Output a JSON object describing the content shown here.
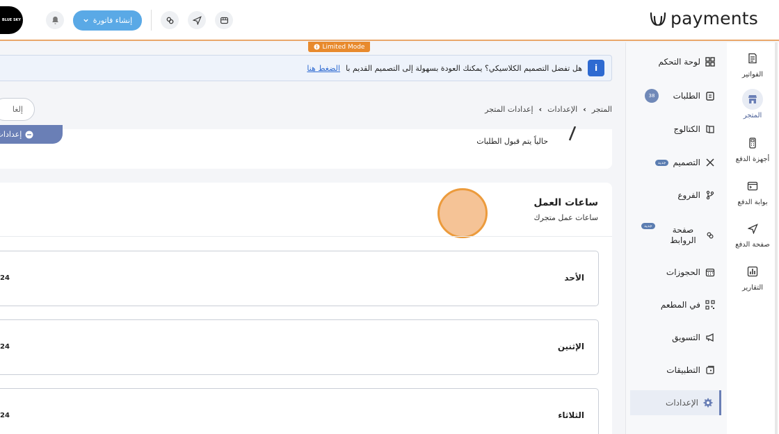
{
  "brand": {
    "name": "payments"
  },
  "header": {
    "avatar_text": "BLUE SKY",
    "create_invoice_label": "إنشاء فاتورة"
  },
  "limited_mode": "Limited Mode",
  "notice": {
    "text": "هل تفضل التصميم الكلاسيكي؟ يمكنك العودة بسهولة إلى التصميم القديم با",
    "link": "الضغط هنا"
  },
  "rail": [
    {
      "label": "الفواتير",
      "icon": "invoice-icon"
    },
    {
      "label": "المتجر",
      "icon": "store-icon"
    },
    {
      "label": "أجهزة الدفع",
      "icon": "pos-device-icon"
    },
    {
      "label": "بوابة الدفع",
      "icon": "gateway-icon"
    },
    {
      "label": "صفحة الدفع",
      "icon": "send-icon"
    },
    {
      "label": "التقارير",
      "icon": "reports-icon"
    }
  ],
  "menu": [
    {
      "label": "لوحة التحكم",
      "icon": "grid-icon"
    },
    {
      "label": "الطلبات",
      "icon": "orders-icon",
      "count": "38"
    },
    {
      "label": "الكتالوج",
      "icon": "catalog-icon"
    },
    {
      "label": "التصميم",
      "icon": "design-icon",
      "badge": "جديد"
    },
    {
      "label": "الفروع",
      "icon": "branch-icon"
    },
    {
      "label": "صفحة الروابط",
      "icon": "link-icon",
      "badge": "جديد"
    },
    {
      "label": "الحجوزات",
      "icon": "calendar-icon"
    },
    {
      "label": "في المطعم",
      "icon": "qr-icon"
    },
    {
      "label": "التسويق",
      "icon": "megaphone-icon"
    },
    {
      "label": "التطبيقات",
      "icon": "apps-icon"
    },
    {
      "label": "الإعدادات",
      "icon": "gear-icon"
    }
  ],
  "breadcrumb": [
    "المتجر",
    "الإعدادات",
    "إعدادات المتجر"
  ],
  "cancel_label": "إلغا",
  "store_status": {
    "accept_text": "حالياً يتم قبول الطلبات",
    "pill_label": "إعدادات ال"
  },
  "working_hours": {
    "title": "ساعات العمل",
    "subtitle": "ساعات عمل متجرك",
    "days": [
      {
        "name": "الأحد",
        "value": "24"
      },
      {
        "name": "الإثنين",
        "value": "24"
      },
      {
        "name": "الثلاثاء",
        "value": "24"
      }
    ]
  }
}
